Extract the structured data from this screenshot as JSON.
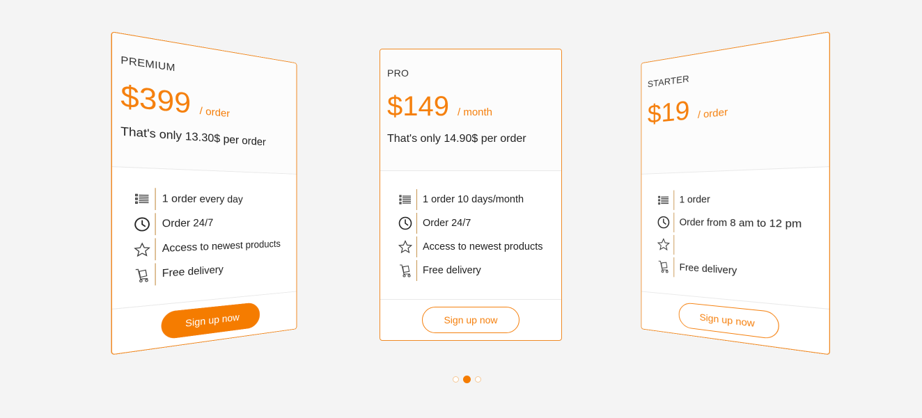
{
  "plans": {
    "premium": {
      "name": "PREMIUM",
      "price": "$399",
      "period": "/ order",
      "note": "That's only 13.30$ per order",
      "features": [
        "1 order every day",
        "Order 24/7",
        "Access to newest products",
        "Free delivery"
      ],
      "button_label": "Sign up now"
    },
    "pro": {
      "name": "PRO",
      "price": "$149",
      "period": "/ month",
      "note": "That's only 14.90$ per order",
      "features": [
        "1 order 10 days/month",
        "Order 24/7",
        "Access to newest products",
        "Free delivery"
      ],
      "button_label": "Sign up now"
    },
    "starter": {
      "name": "STARTER",
      "price": "$19",
      "period": "/ order",
      "note": "",
      "features": [
        "1 order",
        "Order from 8 am to 12 pm",
        "",
        "Free delivery"
      ],
      "button_label": "Sign up now"
    }
  },
  "feature_icons": [
    "list-icon",
    "clock-icon",
    "star-icon",
    "delivery-cart-icon"
  ],
  "carousel": {
    "dot_count": 3,
    "active_index": 1
  },
  "colors": {
    "accent": "#f57c00",
    "border": "#f08a24",
    "background": "#f4f4f4"
  }
}
